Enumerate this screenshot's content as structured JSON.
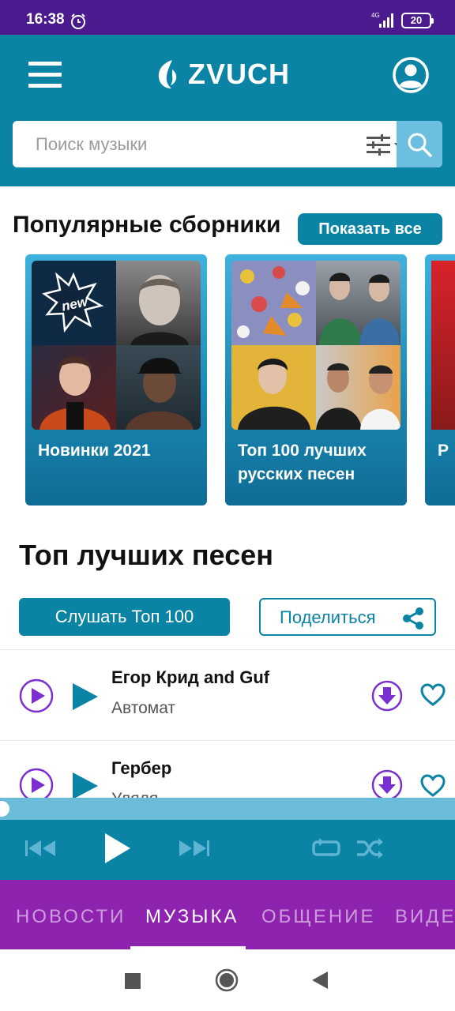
{
  "status_bar": {
    "time": "16:38",
    "network": "4G",
    "battery": "20"
  },
  "header": {
    "logo_text": "ZVUCH",
    "menu_icon": "hamburger-menu-icon",
    "profile_icon": "profile-icon"
  },
  "search": {
    "placeholder": "Поиск музыки",
    "filter_icon": "filter-sliders-icon",
    "search_icon": "search-icon"
  },
  "popular": {
    "title": "Популярные сборники",
    "show_all_label": "Показать все",
    "collections": [
      {
        "title": "Новинки 2021",
        "badge": "new"
      },
      {
        "title": "Топ 100 лучших русских песен"
      },
      {
        "title": "Р"
      }
    ]
  },
  "top": {
    "title": "Топ лучших песен",
    "listen_label": "Слушать Топ 100",
    "share_label": "Поделиться",
    "songs": [
      {
        "artist": "Егор Крид and Guf",
        "title": "Автомат"
      },
      {
        "artist": "Гербер",
        "title": "Уляля"
      }
    ]
  },
  "player": {
    "progress": 0.0
  },
  "tabs": [
    {
      "label": "НОВОСТИ",
      "active": false
    },
    {
      "label": "МУЗЫКА",
      "active": true
    },
    {
      "label": "ОБЩЕНИЕ",
      "active": false
    },
    {
      "label": "ВИДЕО",
      "active": false
    }
  ],
  "colors": {
    "accent": "#0b83a5",
    "status_bar": "#4a1a8e",
    "tabs_bg": "#8e23b0",
    "song_icon": "#7b2fd1"
  }
}
